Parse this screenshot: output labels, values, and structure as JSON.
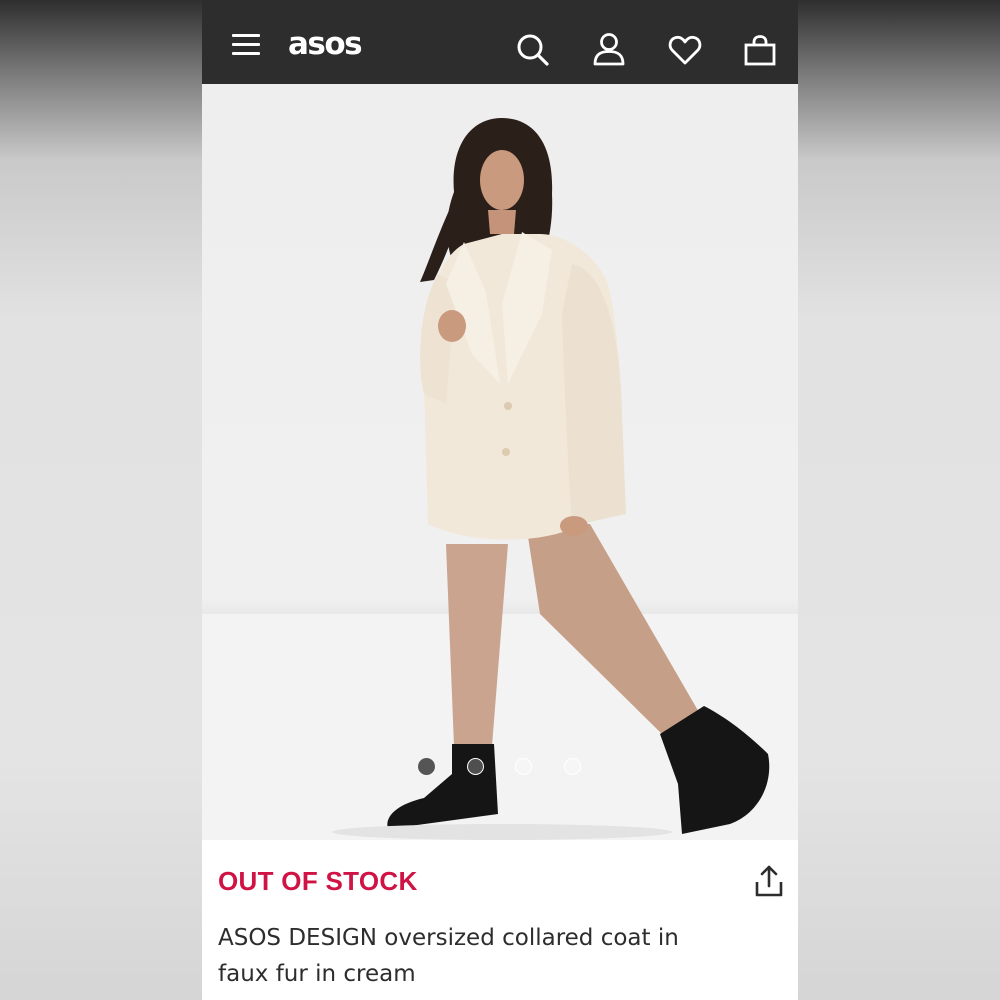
{
  "header": {
    "brand": "asos",
    "icons": [
      "menu-icon",
      "search-icon",
      "account-icon",
      "heart-icon",
      "bag-icon"
    ],
    "background": "#2d2d2d"
  },
  "gallery": {
    "image_count": 4,
    "active_index": 1
  },
  "product": {
    "stock_status": "OUT OF STOCK",
    "stock_color": "#d01345",
    "title_line1": "ASOS DESIGN oversized collared coat in",
    "title_line2": "faux fur in cream"
  }
}
